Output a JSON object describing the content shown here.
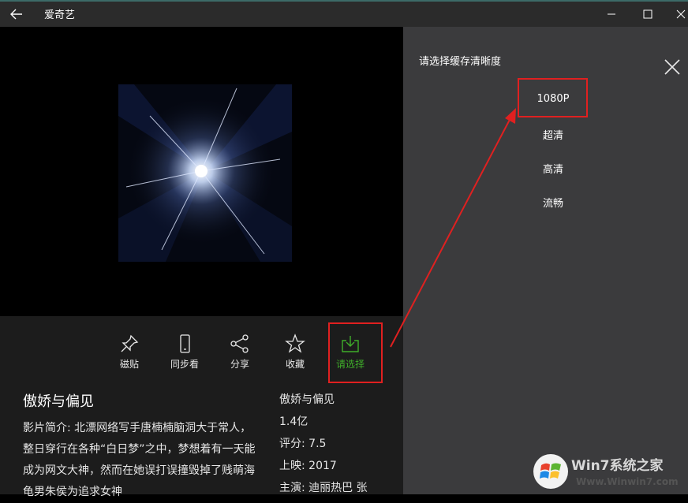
{
  "titlebar": {
    "app_title": "爱奇艺",
    "back_icon": "arrow-left-icon",
    "minimize_icon": "minimize-icon",
    "maximize_icon": "maximize-icon",
    "close_icon": "close-icon"
  },
  "actions": [
    {
      "label": "磁贴",
      "icon": "pin-icon"
    },
    {
      "label": "同步看",
      "icon": "phone-icon"
    },
    {
      "label": "分享",
      "icon": "share-icon"
    },
    {
      "label": "收藏",
      "icon": "star-icon"
    },
    {
      "label": "请选择",
      "icon": "download-icon"
    }
  ],
  "show": {
    "title": "傲娇与偏见",
    "synopsis": "影片简介: 北漂网络写手唐楠楠脑洞大于常人，整日穿行在各种“白日梦”之中，梦想着有一天能成为网文大神，然而在她误打误撞毁掉了贱萌海龟男朱侯为追求女神",
    "meta_title": "傲娇与偏见",
    "views": "1.4亿",
    "rating": "评分: 7.5",
    "release": "上映: 2017",
    "cast": "主演: 迪丽热巴 张"
  },
  "panel": {
    "title": "请选择缓存清晰度",
    "close_icon": "close-icon",
    "options": [
      "1080P",
      "超清",
      "高清",
      "流畅"
    ]
  },
  "colors": {
    "accent_green": "#3fae2a",
    "highlight_red": "#e02020",
    "panel_bg": "#3b3b3d",
    "content_bg": "#1c1c1c"
  },
  "watermark": {
    "brand": "Win7系统之家",
    "site": "Www.Winwin7.com",
    "logo_icon": "windows-logo-icon"
  }
}
